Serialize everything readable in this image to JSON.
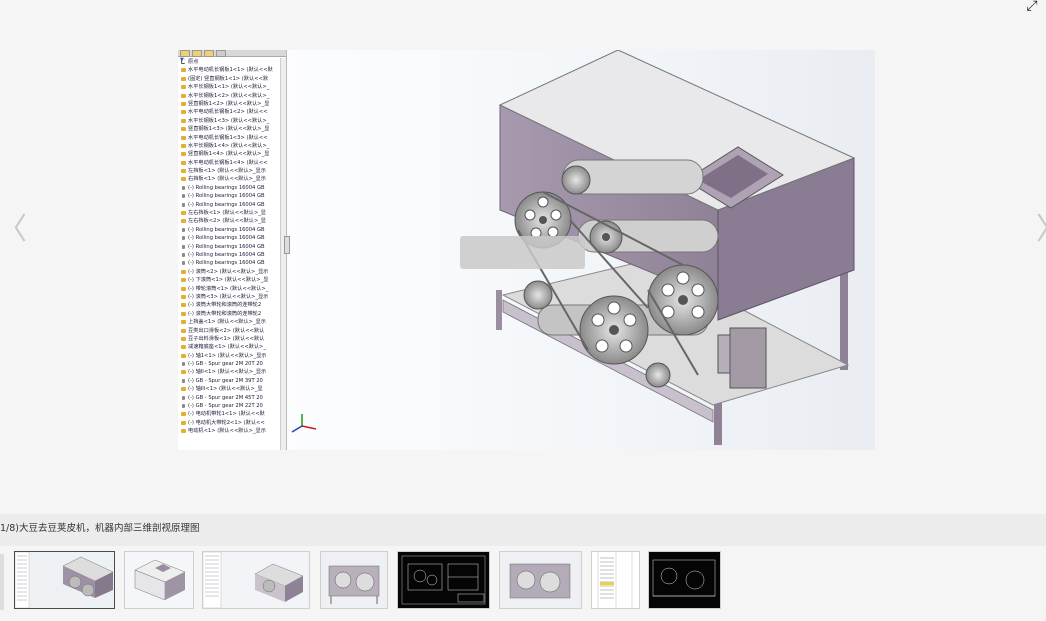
{
  "viewer": {
    "fullscreen_glyph": "⤢",
    "prev_glyph": "〈",
    "next_glyph": "〉"
  },
  "feature_tree": {
    "filter_label": "▼·",
    "items": [
      {
        "label": "原点",
        "icon": "origin-icon"
      },
      {
        "label": "水平电动机长钢板1<1> (默认<<默",
        "icon": "part-icon"
      },
      {
        "label": "(固定) 竖直钢板1<1> (默认<<默",
        "icon": "part-icon"
      },
      {
        "label": "水平长钢板1<1> (默认<<默认>_",
        "icon": "part-icon"
      },
      {
        "label": "水平长钢板1<2> (默认<<默认>_",
        "icon": "part-icon"
      },
      {
        "label": "竖直钢板1<2> (默认<<默认>_显",
        "icon": "part-icon"
      },
      {
        "label": "水平电动机长钢板1<2> (默认<<",
        "icon": "part-icon"
      },
      {
        "label": "水平长钢板1<3> (默认<<默认>_",
        "icon": "part-icon"
      },
      {
        "label": "竖直钢板1<3> (默认<<默认>_显",
        "icon": "part-icon"
      },
      {
        "label": "水平电动机长钢板1<3> (默认<<",
        "icon": "part-icon"
      },
      {
        "label": "水平长钢板1<4> (默认<<默认>_",
        "icon": "part-icon"
      },
      {
        "label": "竖直钢板1<4> (默认<<默认>_显",
        "icon": "part-icon"
      },
      {
        "label": "水平电动机长钢板1<4> (默认<<",
        "icon": "part-icon"
      },
      {
        "label": "左挡板<1> (默认<<默认>_显示",
        "icon": "part-icon"
      },
      {
        "label": "右挡板<1> (默认<<默认>_显示",
        "icon": "part-icon"
      },
      {
        "label": "(-) Rolling bearings 16004 GB",
        "icon": "bearing-icon"
      },
      {
        "label": "(-) Rolling bearings 16004 GB",
        "icon": "bearing-icon"
      },
      {
        "label": "(-) Rolling bearings 16004 GB",
        "icon": "bearing-icon"
      },
      {
        "label": "左右挡板<1> (默认<<默认>_显",
        "icon": "part-icon"
      },
      {
        "label": "左右挡板<2> (默认<<默认>_显",
        "icon": "part-icon"
      },
      {
        "label": "(-) Rolling bearings 16004 GB",
        "icon": "bearing-icon"
      },
      {
        "label": "(-) Rolling bearings 16004 GB",
        "icon": "bearing-icon"
      },
      {
        "label": "(-) Rolling bearings 16004 GB",
        "icon": "bearing-icon"
      },
      {
        "label": "(-) Rolling bearings 16004 GB",
        "icon": "bearing-icon"
      },
      {
        "label": "(-) Rolling bearings 16004 GB",
        "icon": "bearing-icon"
      },
      {
        "label": "(-) 滚筒<2> (默认<<默认>_显示",
        "icon": "part-icon"
      },
      {
        "label": "(-) 下滚筒<1> (默认<<默认>_显",
        "icon": "part-icon"
      },
      {
        "label": "(-) 带轮滚筒<1> (默认<<默认>_",
        "icon": "part-icon"
      },
      {
        "label": "(-) 滚筒<3> (默认<<默认>_显示",
        "icon": "part-icon"
      },
      {
        "label": "(-) 滚筒大带轮和滚筒的连带轮2",
        "icon": "part-icon"
      },
      {
        "label": "(-) 滚筒大带轮和滚筒的连带轮2",
        "icon": "part-icon"
      },
      {
        "label": "上挡盖<1> (默认<<默认>_显示",
        "icon": "part-icon"
      },
      {
        "label": "豆类出口滑板<2> (默认<<默认",
        "icon": "part-icon"
      },
      {
        "label": "豆子出料滑板<1> (默认<<默认",
        "icon": "part-icon"
      },
      {
        "label": "减速箱底座<1> (默认<<默认>_",
        "icon": "part-icon"
      },
      {
        "label": "(-) 轴1<1> (默认<<默认>_显示",
        "icon": "part-icon"
      },
      {
        "label": "(-) GB - Spur gear 2M 20T 20",
        "icon": "bearing-icon"
      },
      {
        "label": "(-) 轴II<1> (默认<<默认>_显示",
        "icon": "part-icon"
      },
      {
        "label": "(-) GB - Spur gear 2M 39T 20",
        "icon": "bearing-icon"
      },
      {
        "label": "(-) 轴III<1> (默认<<默认>_显",
        "icon": "part-icon"
      },
      {
        "label": "(-) GB - Spur gear 2M 45T 20",
        "icon": "bearing-icon"
      },
      {
        "label": "(-) GB - Spur gear 2M 22T 20",
        "icon": "bearing-icon"
      },
      {
        "label": "(-) 电动机带轮1<1> (默认<<默",
        "icon": "part-icon"
      },
      {
        "label": "(-) 电动机大带轮2<1> (默认<<",
        "icon": "part-icon"
      },
      {
        "label": "电动机<1> (默认<<默认>_显示",
        "icon": "part-icon"
      }
    ]
  },
  "caption": {
    "text": "1/8)大豆去豆荚皮机，机器内部三维剖视原理图"
  },
  "thumbnails": [
    {
      "label": "thumb-1",
      "kind": "assembly-with-tree",
      "active": true
    },
    {
      "label": "thumb-2",
      "kind": "closed-box"
    },
    {
      "label": "thumb-3",
      "kind": "assembly-with-tree-2"
    },
    {
      "label": "thumb-4",
      "kind": "side-view"
    },
    {
      "label": "thumb-5",
      "kind": "cad-drawing"
    },
    {
      "label": "thumb-6",
      "kind": "side-view-2"
    },
    {
      "label": "thumb-7",
      "kind": "document"
    },
    {
      "label": "thumb-8",
      "kind": "cad-drawing-2"
    }
  ]
}
